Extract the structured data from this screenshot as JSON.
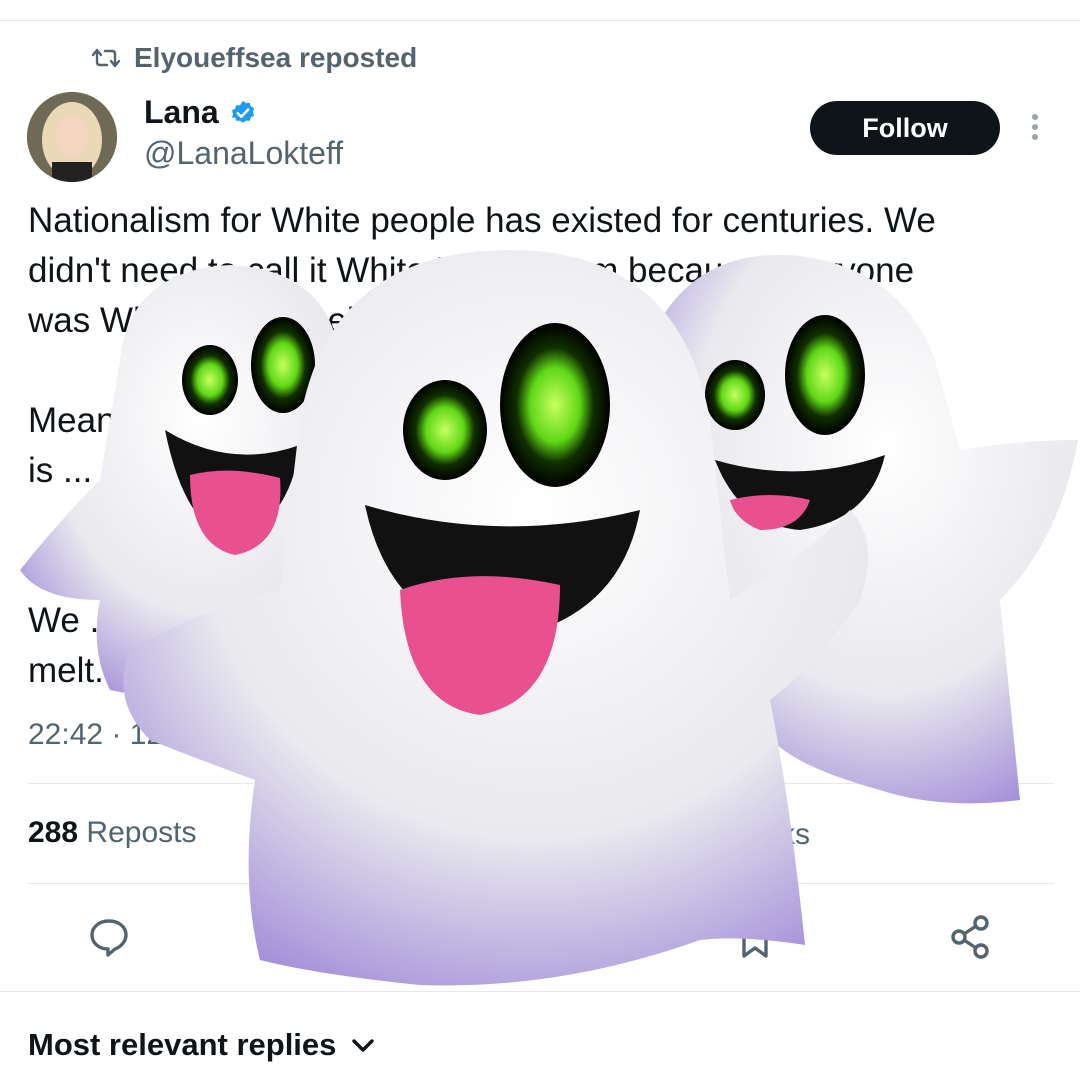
{
  "repost": {
    "label": "Elyoueffsea reposted",
    "icon": "repost-icon"
  },
  "author": {
    "name": "Lana",
    "handle": "@LanaLokteff",
    "verified": true
  },
  "follow_label": "Follow",
  "tweet": {
    "text": "Nationalism for White people has existed for centuries. We\ndidn't need to call it White Nationalism because everyone\nwas White within their borders.\n\nMeanwhile, White Nationalism\nis ...\n\n\nWe ...\nmelt...",
    "timestamp": "22:42 · 12 Jul 23"
  },
  "stats": {
    "reposts_count": "288",
    "reposts_label": "Reposts",
    "other_label": "ks"
  },
  "actions": [
    "reply-icon",
    "repost-icon",
    "bookmark-icon",
    "share-icon"
  ],
  "replies_sort": {
    "label": "Most relevant replies"
  },
  "colors": {
    "follow_bg": "#0f1419",
    "verified": "#1d9bf0",
    "ghost_eye": "#7dff2a",
    "ghost_tongue": "#e8508f"
  }
}
